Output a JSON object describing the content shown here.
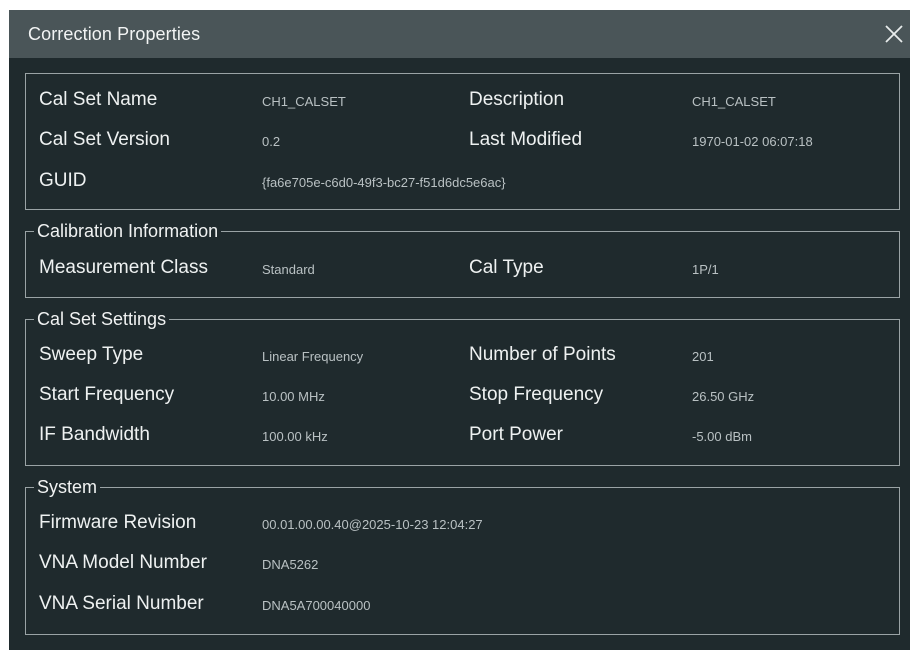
{
  "window": {
    "title": "Correction Properties"
  },
  "calset": {
    "name_label": "Cal Set Name",
    "name_value": "CH1_CALSET",
    "description_label": "Description",
    "description_value": "CH1_CALSET",
    "version_label": "Cal Set Version",
    "version_value": "0.2",
    "modified_label": "Last Modified",
    "modified_value": "1970-01-02 06:07:18",
    "guid_label": "GUID",
    "guid_value": "{fa6e705e-c6d0-49f3-bc27-f51d6dc5e6ac}"
  },
  "calibration": {
    "title": "Calibration Information",
    "class_label": "Measurement Class",
    "class_value": "Standard",
    "type_label": "Cal Type",
    "type_value": "1P/1"
  },
  "settings": {
    "title": "Cal Set Settings",
    "sweep_label": "Sweep Type",
    "sweep_value": "Linear Frequency",
    "points_label": "Number of Points",
    "points_value": "201",
    "start_label": "Start Frequency",
    "start_value": "10.00 MHz",
    "stop_label": "Stop Frequency",
    "stop_value": "26.50 GHz",
    "ifbw_label": "IF Bandwidth",
    "ifbw_value": "100.00 kHz",
    "power_label": "Port Power",
    "power_value": "-5.00 dBm"
  },
  "system": {
    "title": "System",
    "firmware_label": "Firmware Revision",
    "firmware_value": "00.01.00.00.40@2025-10-23 12:04:27",
    "model_label": "VNA Model Number",
    "model_value": "DNA5262",
    "serial_label": "VNA Serial Number",
    "serial_value": "DNA5A700040000"
  },
  "icons": {
    "close": "close-icon"
  },
  "colors": {
    "titlebar": "#4a5558",
    "background": "#1f2a2d",
    "border": "#9aa3a5"
  }
}
